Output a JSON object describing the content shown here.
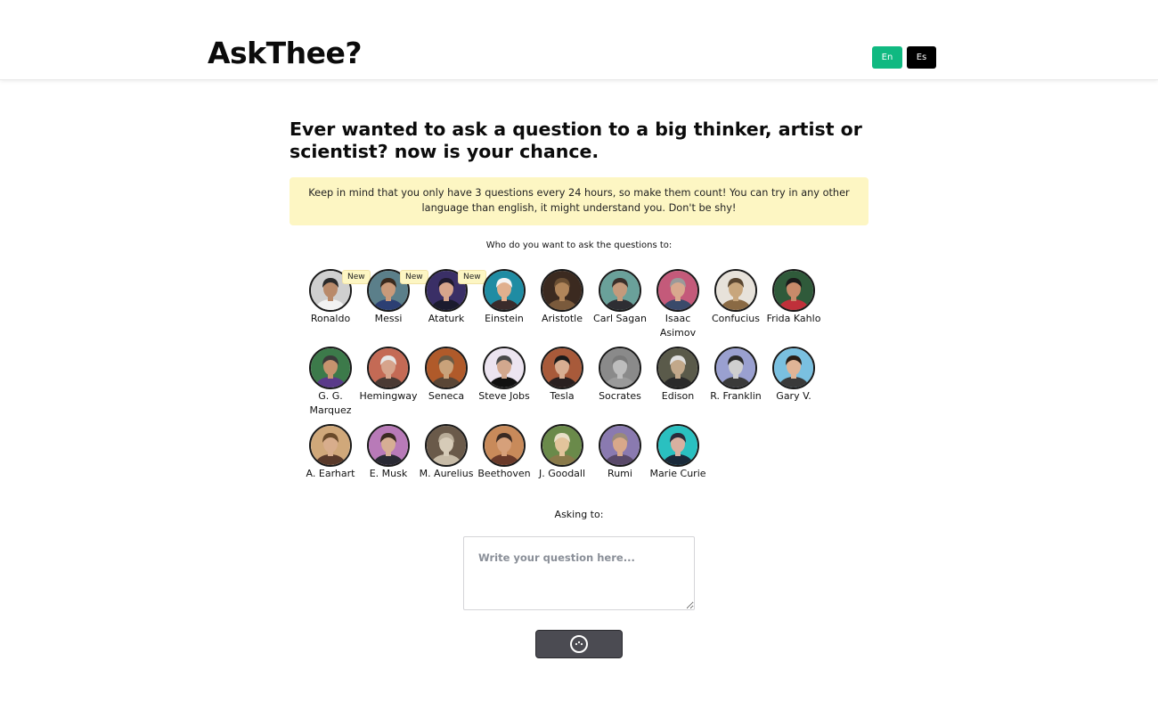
{
  "header": {
    "logo": "AskThee?",
    "languages": [
      {
        "label": "En",
        "color": "#10b981"
      },
      {
        "label": "Es",
        "color": "#000000"
      }
    ]
  },
  "main": {
    "headline": "Ever wanted to ask a question to a big thinker, artist or scientist? now is your chance.",
    "notice": "Keep in mind that you only have 3 questions every 24 hours, so make them count!  You can try in any other language than english, it might understand you. Don't be shy!",
    "prompt": "Who do you want to ask the questions to:",
    "people": [
      {
        "name": "Ronaldo",
        "badge": "New",
        "bg": "#cfcfcf",
        "skin": "#b98a6a",
        "hair": "#2a2a2a",
        "shirt": "#f2f2f2"
      },
      {
        "name": "Messi",
        "badge": "New",
        "bg": "#5b7f8a",
        "skin": "#c99a7a",
        "hair": "#3a2a1e",
        "shirt": "#2c3f73"
      },
      {
        "name": "Ataturk",
        "badge": "New",
        "bg": "#3a2f66",
        "skin": "#d7a58c",
        "hair": "#1f1a2e",
        "shirt": "#1b1b2e"
      },
      {
        "name": "Einstein",
        "bg": "#1f8ca3",
        "skin": "#e0b08e",
        "hair": "#f4f4f4",
        "shirt": "#3a2b2b"
      },
      {
        "name": "Aristotle",
        "bg": "#3b2a20",
        "skin": "#b0855a",
        "hair": "#6b4f33",
        "shirt": "#7a5a3c"
      },
      {
        "name": "Carl Sagan",
        "bg": "#6aa19a",
        "skin": "#c49a7c",
        "hair": "#3a2f2a",
        "shirt": "#2e2e33"
      },
      {
        "name": "Isaac Asimov",
        "bg": "#c45a7a",
        "skin": "#d9a88e",
        "hair": "#9a9a9a",
        "shirt": "#3a4a6a"
      },
      {
        "name": "Confucius",
        "bg": "#e7e2da",
        "skin": "#c8a67c",
        "hair": "#5a4630",
        "shirt": "#8a6a44"
      },
      {
        "name": "Frida Kahlo",
        "bg": "#2f5a3a",
        "skin": "#c88a6a",
        "hair": "#1a1a1a",
        "shirt": "#c0303a"
      },
      {
        "name": "G. G. Marquez",
        "bg": "#3c7a4a",
        "skin": "#c6936e",
        "hair": "#3a3a3a",
        "shirt": "#5a3a8a"
      },
      {
        "name": "Hemingway",
        "bg": "#c46a55",
        "skin": "#d6a48c",
        "hair": "#e6e6e6",
        "shirt": "#4a3a34"
      },
      {
        "name": "Seneca",
        "bg": "#b05a2a",
        "skin": "#c9a27a",
        "hair": "#6a5a44",
        "shirt": "#5a4636"
      },
      {
        "name": "Steve Jobs",
        "bg": "#ece4f0",
        "skin": "#d2a88e",
        "hair": "#4a4a4a",
        "shirt": "#111111"
      },
      {
        "name": "Tesla",
        "bg": "#a85a3a",
        "skin": "#d8ae92",
        "hair": "#1a1a1a",
        "shirt": "#2a2020"
      },
      {
        "name": "Socrates",
        "bg": "#8a8a8a",
        "skin": "#bdbdbd",
        "hair": "#7a7a7a",
        "shirt": "#9a9a9a"
      },
      {
        "name": "Edison",
        "bg": "#5a5a4a",
        "skin": "#c2a88a",
        "hair": "#e0e0e0",
        "shirt": "#2a2a2a"
      },
      {
        "name": "R. Franklin",
        "bg": "#9aa0d0",
        "skin": "#cfcfcf",
        "hair": "#2a2a2a",
        "shirt": "#3a3a3a"
      },
      {
        "name": "Gary V.",
        "bg": "#7ac0e0",
        "skin": "#e0b496",
        "hair": "#2a1e16",
        "shirt": "#3a3a3a"
      },
      {
        "name": "A. Earhart",
        "bg": "#d0a87a",
        "skin": "#d8ad8c",
        "hair": "#6a4a2a",
        "shirt": "#5a3a2a"
      },
      {
        "name": "E. Musk",
        "bg": "#b87ab8",
        "skin": "#d6ae94",
        "hair": "#3a2a22",
        "shirt": "#2a2a34"
      },
      {
        "name": "M. Aurelius",
        "bg": "#6a5a4a",
        "skin": "#d6cbb8",
        "hair": "#b8ac98",
        "shirt": "#c8bca8"
      },
      {
        "name": "Beethoven",
        "bg": "#c88a5a",
        "skin": "#d6a07a",
        "hair": "#3a2a22",
        "shirt": "#6a3a2a"
      },
      {
        "name": "J. Goodall",
        "bg": "#6a8a4a",
        "skin": "#e2c49c",
        "hair": "#e8e0c8",
        "shirt": "#8a7a4a"
      },
      {
        "name": "Rumi",
        "bg": "#8a7ab0",
        "skin": "#d8a88a",
        "hair": "#9a8a7a",
        "shirt": "#5a4a6a"
      },
      {
        "name": "Marie Curie",
        "bg": "#2ac0c0",
        "skin": "#d8b0a0",
        "hair": "#2a2a3a",
        "shirt": "#1a2a3a"
      }
    ],
    "asking_label": "Asking to:",
    "question_placeholder": "Write your question here...",
    "submit_icon": "loading-spinner-icon"
  }
}
